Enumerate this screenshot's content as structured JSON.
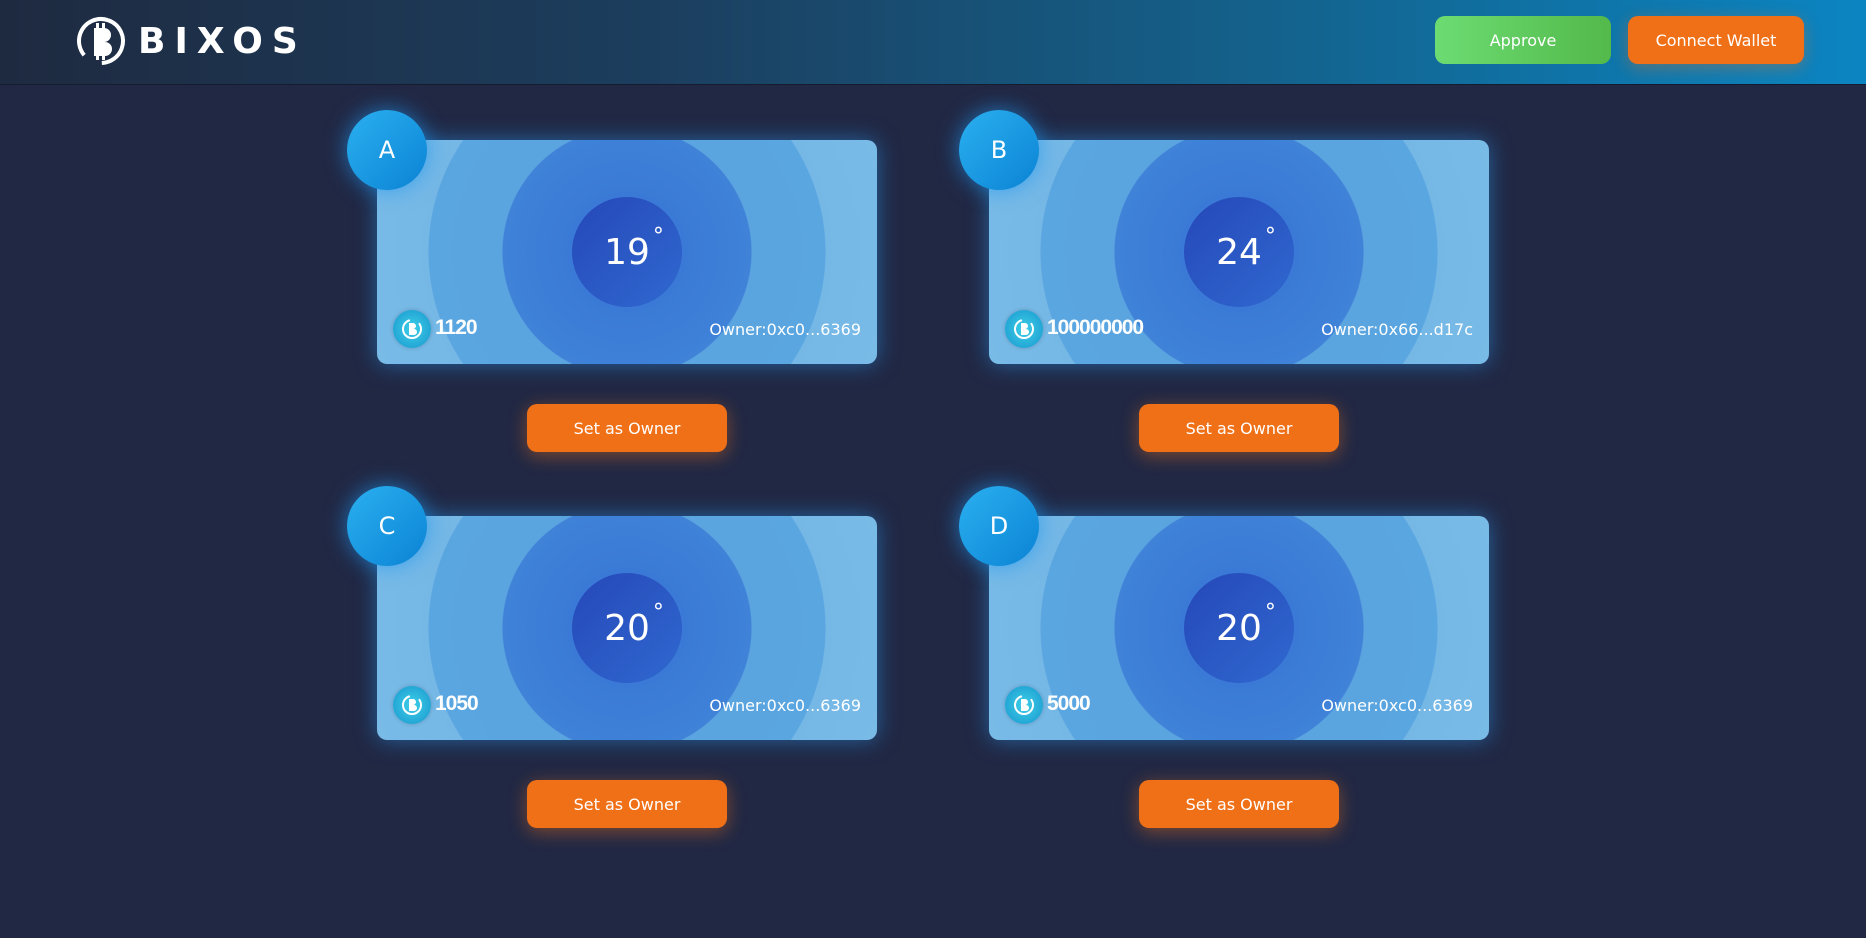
{
  "header": {
    "logo_text": "BIXOS",
    "approve_label": "Approve",
    "connect_label": "Connect Wallet"
  },
  "colors": {
    "background": "#212844",
    "accent_orange": "#f07018",
    "approve_green": "#5fcb5e",
    "badge_blue": "#1a9be3"
  },
  "cards": [
    {
      "id": "A",
      "temperature": "19",
      "degree_symbol": "°",
      "balance": "1120",
      "owner": "Owner:0xc0...6369",
      "button_label": "Set as Owner"
    },
    {
      "id": "B",
      "temperature": "24",
      "degree_symbol": "°",
      "balance": "100000000",
      "owner": "Owner:0x66...d17c",
      "button_label": "Set as Owner"
    },
    {
      "id": "C",
      "temperature": "20",
      "degree_symbol": "°",
      "balance": "1050",
      "owner": "Owner:0xc0...6369",
      "button_label": "Set as Owner"
    },
    {
      "id": "D",
      "temperature": "20",
      "degree_symbol": "°",
      "balance": "5000",
      "owner": "Owner:0xc0...6369",
      "button_label": "Set as Owner"
    }
  ]
}
